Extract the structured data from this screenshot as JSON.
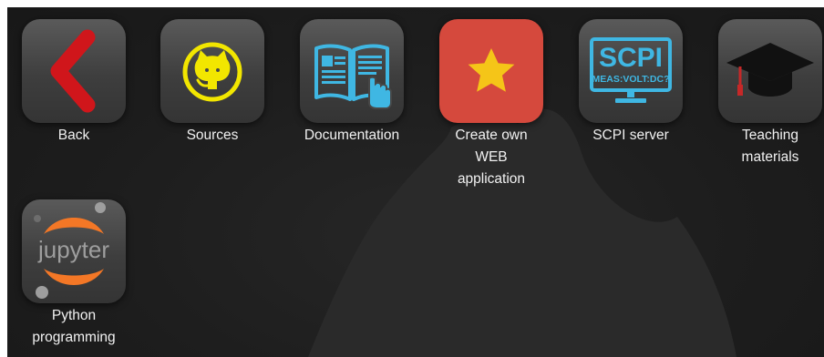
{
  "apps": [
    {
      "label": "Back",
      "icon": "back-chevron-icon"
    },
    {
      "label": "Sources",
      "icon": "github-octocat-icon"
    },
    {
      "label": "Documentation",
      "icon": "open-book-icon"
    },
    {
      "label": "Create own\nWEB\napplication",
      "icon": "star-icon"
    },
    {
      "label": "SCPI server",
      "icon": "scpi-monitor-icon",
      "screen_title": "SCPI",
      "screen_command": "MEAS:VOLT:DC?"
    },
    {
      "label": "Teaching\nmaterials",
      "icon": "graduation-cap-icon"
    },
    {
      "label": "Python\nprogramming",
      "icon": "jupyter-icon",
      "logo_text": "jupyter"
    }
  ],
  "colors": {
    "background": "#1d1d1d",
    "tile": "#474747",
    "accent_red": "#d5493d",
    "star": "#f5c518",
    "cyan": "#3fb7e3",
    "github_yellow": "#f2e600",
    "jupyter_orange": "#f37726"
  }
}
